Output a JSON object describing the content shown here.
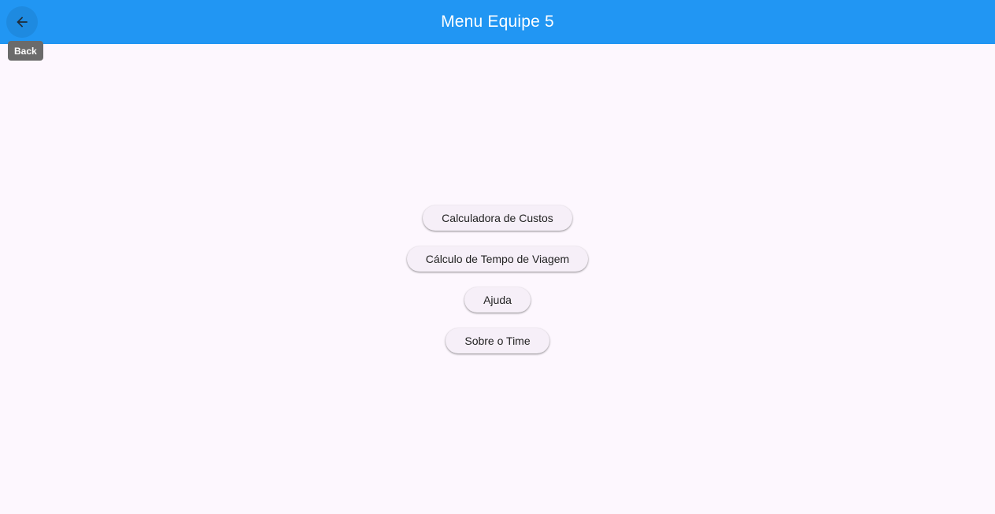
{
  "appbar": {
    "title": "Menu Equipe 5",
    "color": "#2196f3",
    "back_icon": "arrow-back-icon",
    "back_tooltip": "Back"
  },
  "menu": {
    "items": [
      {
        "label": "Calculadora de Custos"
      },
      {
        "label": "Cálculo de Tempo de Viagem"
      },
      {
        "label": "Ajuda"
      },
      {
        "label": "Sobre o Time"
      }
    ]
  },
  "colors": {
    "background": "#fdf7fe",
    "button_bg": "#f6eff8"
  }
}
